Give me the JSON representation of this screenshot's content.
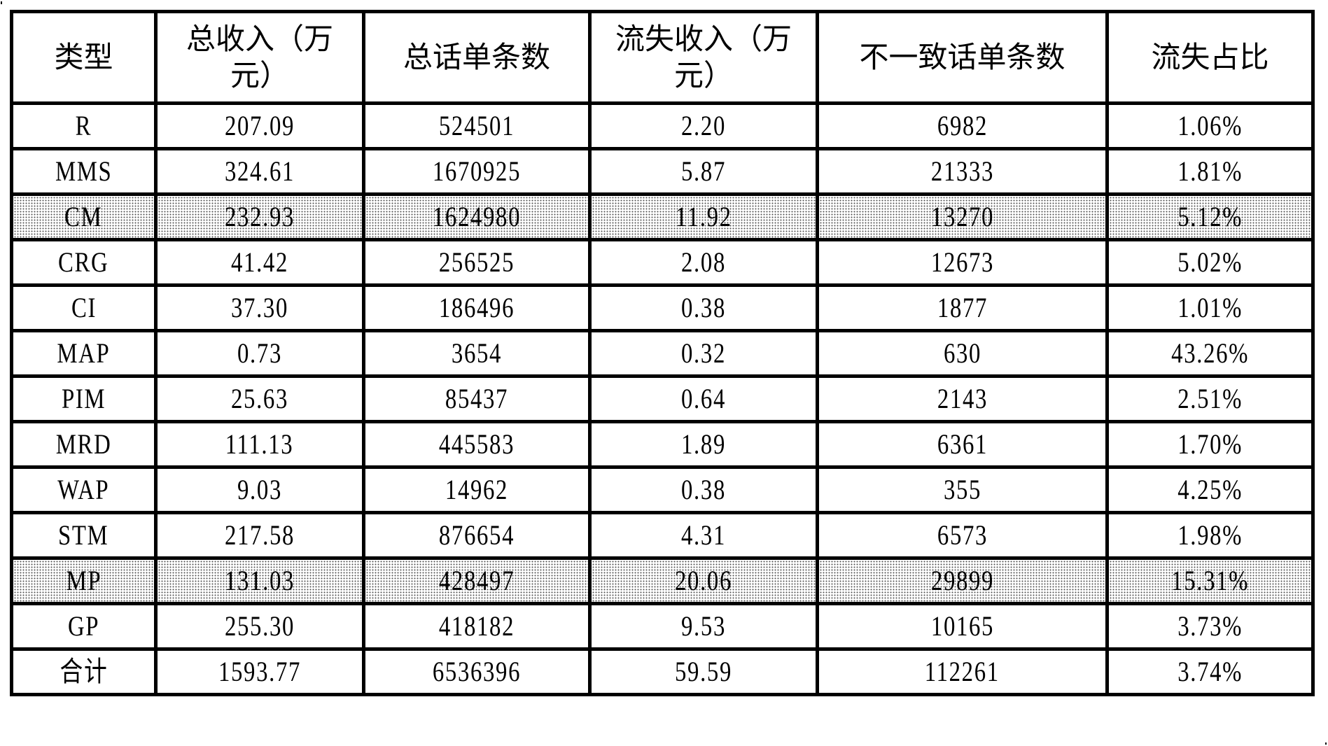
{
  "table": {
    "headers": [
      "类型",
      "总收入（万元）",
      "总话单条数",
      "流失收入（万元）",
      "不一致话单条数",
      "流失占比"
    ],
    "rows": [
      {
        "type": "R",
        "total_income": "207.09",
        "total_records": "524501",
        "lost_income": "2.20",
        "inconsistent_records": "6982",
        "loss_ratio": "1.06%",
        "highlighted": false
      },
      {
        "type": "MMS",
        "total_income": "324.61",
        "total_records": "1670925",
        "lost_income": "5.87",
        "inconsistent_records": "21333",
        "loss_ratio": "1.81%",
        "highlighted": false
      },
      {
        "type": "CM",
        "total_income": "232.93",
        "total_records": "1624980",
        "lost_income": "11.92",
        "inconsistent_records": "13270",
        "loss_ratio": "5.12%",
        "highlighted": true
      },
      {
        "type": "CRG",
        "total_income": "41.42",
        "total_records": "256525",
        "lost_income": "2.08",
        "inconsistent_records": "12673",
        "loss_ratio": "5.02%",
        "highlighted": false
      },
      {
        "type": "CI",
        "total_income": "37.30",
        "total_records": "186496",
        "lost_income": "0.38",
        "inconsistent_records": "1877",
        "loss_ratio": "1.01%",
        "highlighted": false
      },
      {
        "type": "MAP",
        "total_income": "0.73",
        "total_records": "3654",
        "lost_income": "0.32",
        "inconsistent_records": "630",
        "loss_ratio": "43.26%",
        "highlighted": false
      },
      {
        "type": "PIM",
        "total_income": "25.63",
        "total_records": "85437",
        "lost_income": "0.64",
        "inconsistent_records": "2143",
        "loss_ratio": "2.51%",
        "highlighted": false
      },
      {
        "type": "MRD",
        "total_income": "111.13",
        "total_records": "445583",
        "lost_income": "1.89",
        "inconsistent_records": "6361",
        "loss_ratio": "1.70%",
        "highlighted": false
      },
      {
        "type": "WAP",
        "total_income": "9.03",
        "total_records": "14962",
        "lost_income": "0.38",
        "inconsistent_records": "355",
        "loss_ratio": "4.25%",
        "highlighted": false
      },
      {
        "type": "STM",
        "total_income": "217.58",
        "total_records": "876654",
        "lost_income": "4.31",
        "inconsistent_records": "6573",
        "loss_ratio": "1.98%",
        "highlighted": false
      },
      {
        "type": "MP",
        "total_income": "131.03",
        "total_records": "428497",
        "lost_income": "20.06",
        "inconsistent_records": "29899",
        "loss_ratio": "15.31%",
        "highlighted": true
      },
      {
        "type": "GP",
        "total_income": "255.30",
        "total_records": "418182",
        "lost_income": "9.53",
        "inconsistent_records": "10165",
        "loss_ratio": "3.73%",
        "highlighted": false
      },
      {
        "type": "合计",
        "total_income": "1593.77",
        "total_records": "6536396",
        "lost_income": "59.59",
        "inconsistent_records": "112261",
        "loss_ratio": "3.74%",
        "highlighted": false
      }
    ]
  }
}
